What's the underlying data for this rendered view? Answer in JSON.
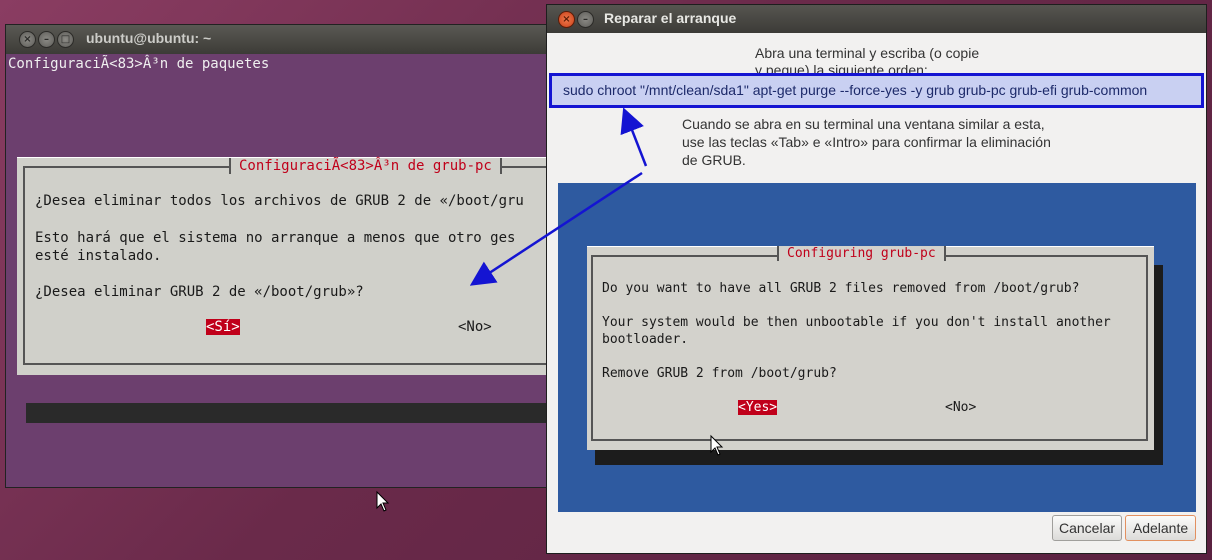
{
  "terminal": {
    "title": "ubuntu@ubuntu: ~",
    "line1": "ConfiguraciÃ<83>Â³n de paquetes",
    "dialog": {
      "title": "ConfiguraciÃ<83>Â³n de grub-pc",
      "line1": "¿Desea eliminar todos los archivos de GRUB 2 de «/boot/gru",
      "line2": "Esto hará que el sistema no arranque a menos que otro ges",
      "line3": "esté instalado.",
      "line4": "¿Desea eliminar GRUB 2 de «/boot/grub»?",
      "yes": "<Sí>",
      "no": "<No>"
    }
  },
  "repair": {
    "title": "Reparar el arranque",
    "instruction1_line1": "Abra una terminal y escriba (o copie",
    "instruction1_line2": "y pegue) la siguiente orden:",
    "command": "sudo chroot \"/mnt/clean/sda1\" apt-get purge --force-yes -y grub grub-pc grub-efi grub-common",
    "instruction2_line1": "Cuando se abra en su terminal una ventana similar a esta,",
    "instruction2_line2": "use las teclas «Tab» e «Intro» para confirmar la eliminación",
    "instruction2_line3": "de GRUB.",
    "example": {
      "title": "Configuring grub-pc",
      "line1": "Do you want to have all GRUB 2 files removed from /boot/grub?",
      "line2": "Your system would be then unbootable if you don't install another",
      "line3": "bootloader.",
      "line4": "Remove GRUB 2 from /boot/grub?",
      "yes": "<Yes>",
      "no": "<No>"
    },
    "cancel_label": "Cancelar",
    "next_label": "Adelante"
  },
  "colors": {
    "terminal_bg": "#6c3f6e",
    "highlight_border": "#1414d2",
    "selected_button": "#c0001a",
    "example_bg": "#2e5aa0"
  }
}
